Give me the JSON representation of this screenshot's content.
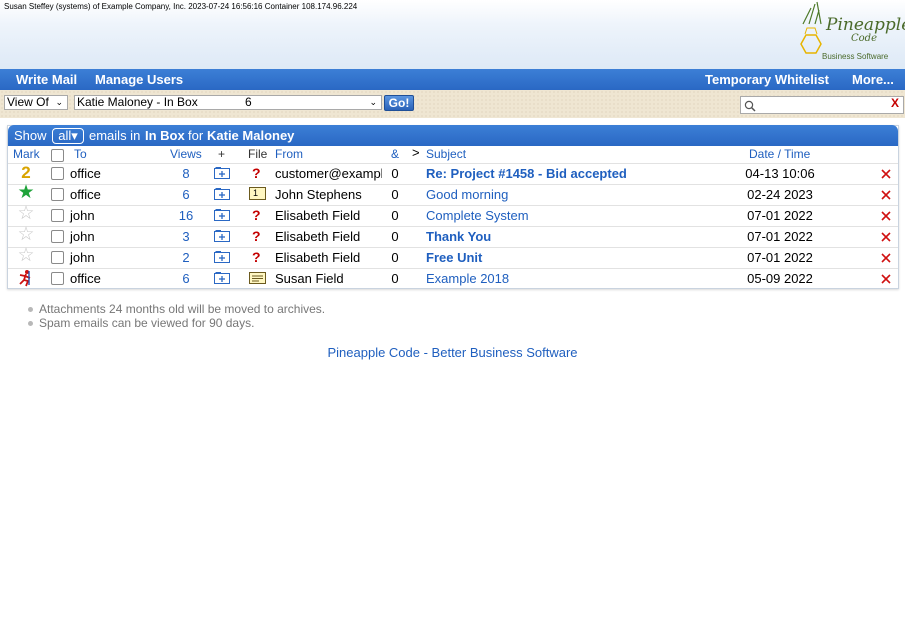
{
  "header": {
    "info": "Susan Steffey (systems) of Example Company, Inc. 2023-07-24 16:56:16 Container 108.174.96.224",
    "logo_word": "Pineapple",
    "logo_sub": "Code",
    "logo_tag": "Business Software"
  },
  "nav": {
    "write_mail": "Write Mail",
    "manage_users": "Manage Users",
    "temporary_whitelist": "Temporary Whitelist",
    "more": "More..."
  },
  "toolbar": {
    "view_of": "View Of",
    "mailbox_select": "Katie Maloney - In Box",
    "mailbox_count": "6",
    "go": "Go!",
    "search_value": "",
    "search_clear": "X"
  },
  "panel": {
    "show": "Show",
    "show_value": "all▾",
    "emails_in": "emails in",
    "folder": "In Box",
    "for": "for",
    "user": "Katie Maloney"
  },
  "columns": {
    "mark": "Mark",
    "to": "To",
    "views": "Views",
    "plus": "+",
    "file": "File",
    "from": "From",
    "amp": "&",
    "chevron": ">",
    "subject": "Subject",
    "datetime": "Date / Time"
  },
  "rows": [
    {
      "mark": "2",
      "mark_color": "#d9a400",
      "to": "office",
      "views": "8",
      "file": "?",
      "from": "customer@example",
      "amp": "0",
      "subject": "Re: Project #1458 - Bid accepted",
      "bold": true,
      "date": "04-13 10:06"
    },
    {
      "mark": "★",
      "mark_color": "#1fa33a",
      "to": "office",
      "views": "6",
      "file": "1",
      "from": "John Stephens",
      "amp": "0",
      "subject": "Good morning",
      "bold": false,
      "date": "02-24 2023"
    },
    {
      "mark": "☆",
      "mark_color": "#c8c8c8",
      "to": "john",
      "views": "16",
      "file": "?",
      "from": "Elisabeth Field",
      "amp": "0",
      "subject": "Complete System",
      "bold": false,
      "date": "07-01 2022"
    },
    {
      "mark": "☆",
      "mark_color": "#c8c8c8",
      "to": "john",
      "views": "3",
      "file": "?",
      "from": "Elisabeth Field",
      "amp": "0",
      "subject": "Thank You",
      "bold": true,
      "date": "07-01 2022"
    },
    {
      "mark": "☆",
      "mark_color": "#c8c8c8",
      "to": "john",
      "views": "2",
      "file": "?",
      "from": "Elisabeth Field",
      "amp": "0",
      "subject": "Free Unit",
      "bold": true,
      "date": "07-01 2022"
    },
    {
      "mark": "runner",
      "mark_color": "#cc1010",
      "to": "office",
      "views": "6",
      "file": "doc",
      "from": "Susan Field",
      "amp": "0",
      "subject": "Example 2018",
      "bold": false,
      "date": "05-09 2022"
    }
  ],
  "notes": [
    "Attachments 24 months old will be moved to archives.",
    "Spam emails can be viewed for 90 days."
  ],
  "footer": {
    "link": "Pineapple Code - Better Business Software"
  }
}
